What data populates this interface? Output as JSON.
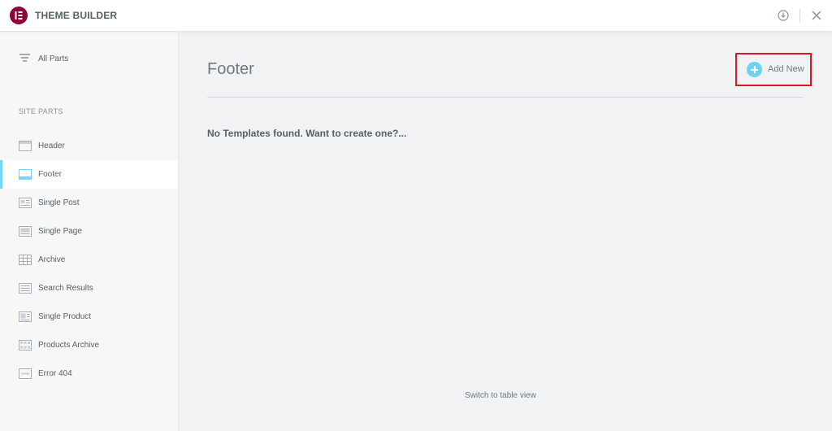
{
  "topbar": {
    "title": "THEME BUILDER",
    "logo_icon": "elementor-logo-icon",
    "info_icon": "info-icon",
    "close_icon": "close-icon"
  },
  "sidebar": {
    "all_parts_label": "All Parts",
    "section_title": "SITE PARTS",
    "items": [
      {
        "label": "Header",
        "icon": "header-icon"
      },
      {
        "label": "Footer",
        "icon": "footer-icon",
        "active": true
      },
      {
        "label": "Single Post",
        "icon": "single-post-icon"
      },
      {
        "label": "Single Page",
        "icon": "single-page-icon"
      },
      {
        "label": "Archive",
        "icon": "archive-icon"
      },
      {
        "label": "Search Results",
        "icon": "search-results-icon"
      },
      {
        "label": "Single Product",
        "icon": "single-product-icon"
      },
      {
        "label": "Products Archive",
        "icon": "products-archive-icon"
      },
      {
        "label": "Error 404",
        "icon": "error-404-icon"
      }
    ]
  },
  "main": {
    "title": "Footer",
    "add_new_label": "Add New",
    "empty_message": "No Templates found. Want to create one?...",
    "switch_view_label": "Switch to table view"
  },
  "colors": {
    "brand": "#92003b",
    "accent": "#71d7f7",
    "highlight_border": "#e0141e"
  }
}
